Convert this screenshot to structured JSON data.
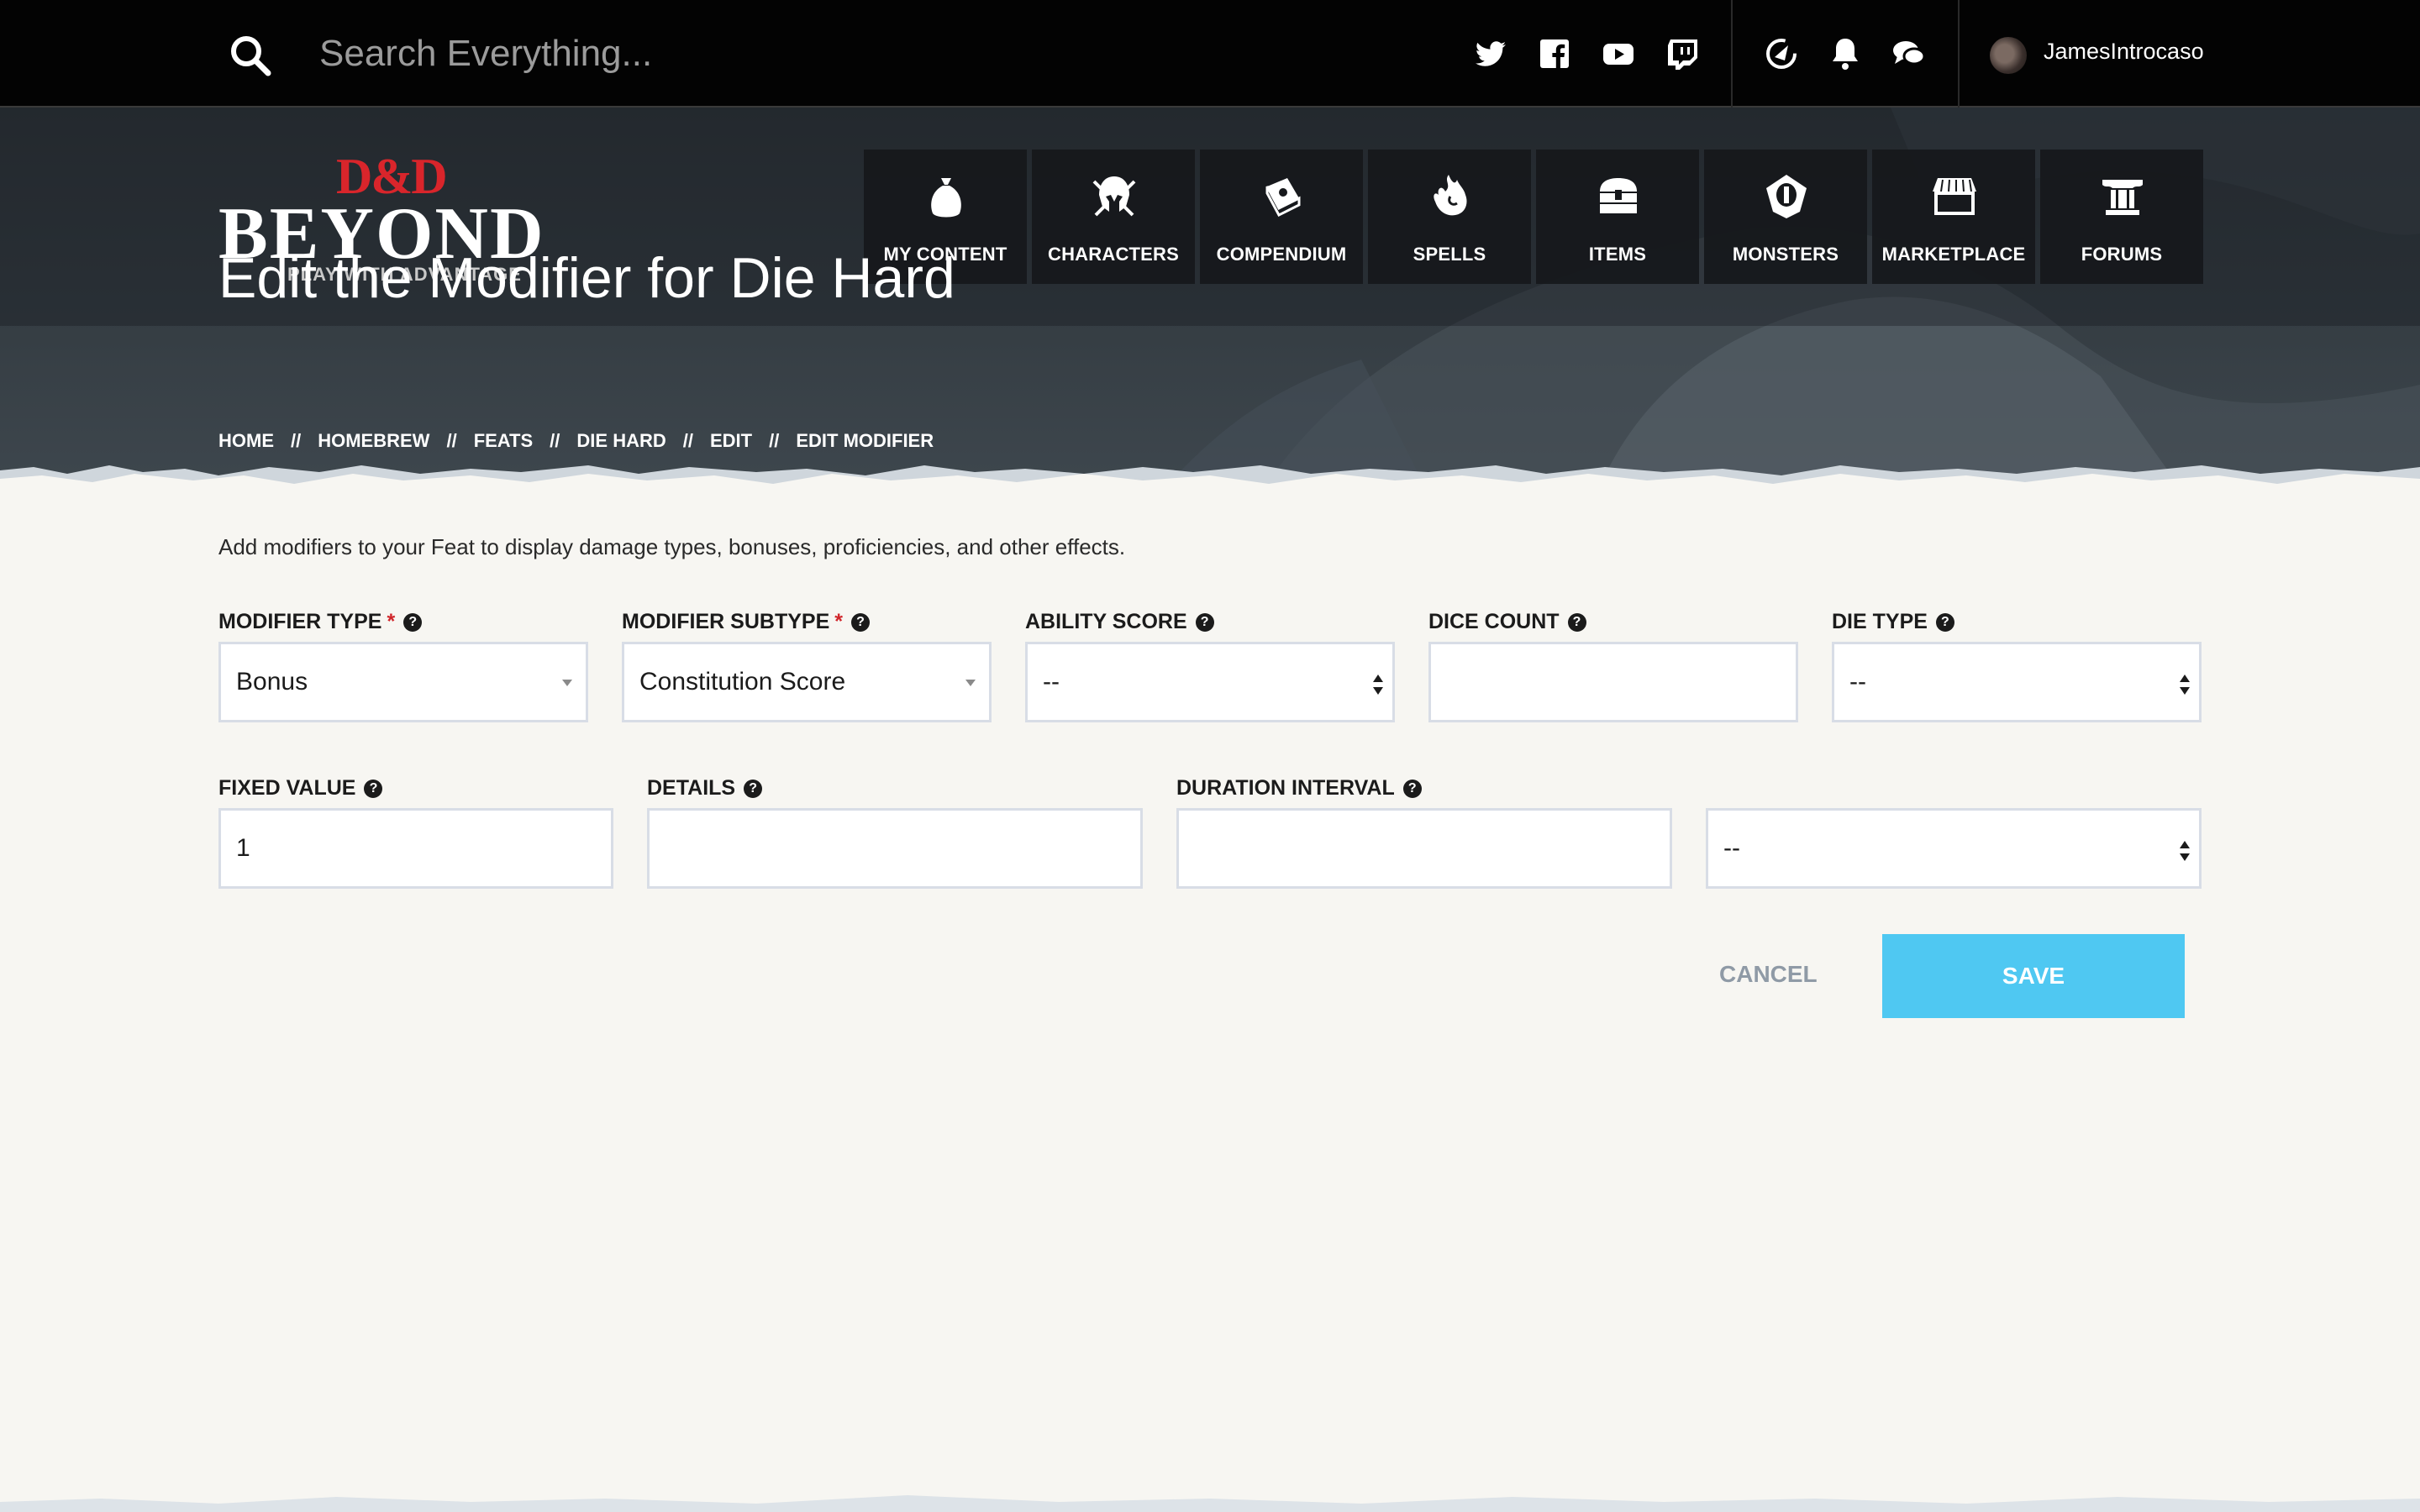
{
  "topbar": {
    "search_placeholder": "Search Everything...",
    "social_icons": [
      "twitter-icon",
      "facebook-icon",
      "youtube-icon",
      "twitch-icon"
    ],
    "utility_icons": [
      "quick-actions-icon",
      "notifications-icon",
      "messages-icon"
    ],
    "username": "JamesIntrocaso"
  },
  "logo": {
    "dd": "D&D",
    "beyond": "BEYOND",
    "tagline": "PLAY WITH ADVANTAGE"
  },
  "nav": [
    {
      "label": "MY CONTENT",
      "icon": "bag-icon"
    },
    {
      "label": "CHARACTERS",
      "icon": "helmet-icon"
    },
    {
      "label": "COMPENDIUM",
      "icon": "book-icon"
    },
    {
      "label": "SPELLS",
      "icon": "flame-hand-icon"
    },
    {
      "label": "ITEMS",
      "icon": "chest-icon"
    },
    {
      "label": "MONSTERS",
      "icon": "eye-shield-icon"
    },
    {
      "label": "MARKETPLACE",
      "icon": "storefront-icon"
    },
    {
      "label": "FORUMS",
      "icon": "pillar-icon"
    }
  ],
  "page": {
    "title": "Edit the Modifier for Die Hard",
    "breadcrumb": [
      "HOME",
      "HOMEBREW",
      "FEATS",
      "DIE HARD",
      "EDIT",
      "EDIT MODIFIER"
    ],
    "breadcrumb_sep": "//",
    "intro": "Add modifiers to your Feat to display damage types, bonuses, proficiencies, and other effects."
  },
  "form": {
    "modifier_type": {
      "label": "MODIFIER TYPE",
      "required": "*",
      "value": "Bonus"
    },
    "modifier_subtype": {
      "label": "MODIFIER SUBTYPE",
      "required": "*",
      "value": "Constitution Score"
    },
    "ability_score": {
      "label": "ABILITY SCORE",
      "value": "--"
    },
    "dice_count": {
      "label": "DICE COUNT",
      "value": ""
    },
    "die_type": {
      "label": "DIE TYPE",
      "value": "--"
    },
    "fixed_value": {
      "label": "FIXED VALUE",
      "value": "1"
    },
    "details": {
      "label": "DETAILS",
      "value": ""
    },
    "duration_interval": {
      "label": "DURATION INTERVAL",
      "value": ""
    },
    "duration_unit": {
      "value": "--"
    },
    "help_glyph": "?"
  },
  "actions": {
    "cancel": "CANCEL",
    "save": "SAVE"
  }
}
